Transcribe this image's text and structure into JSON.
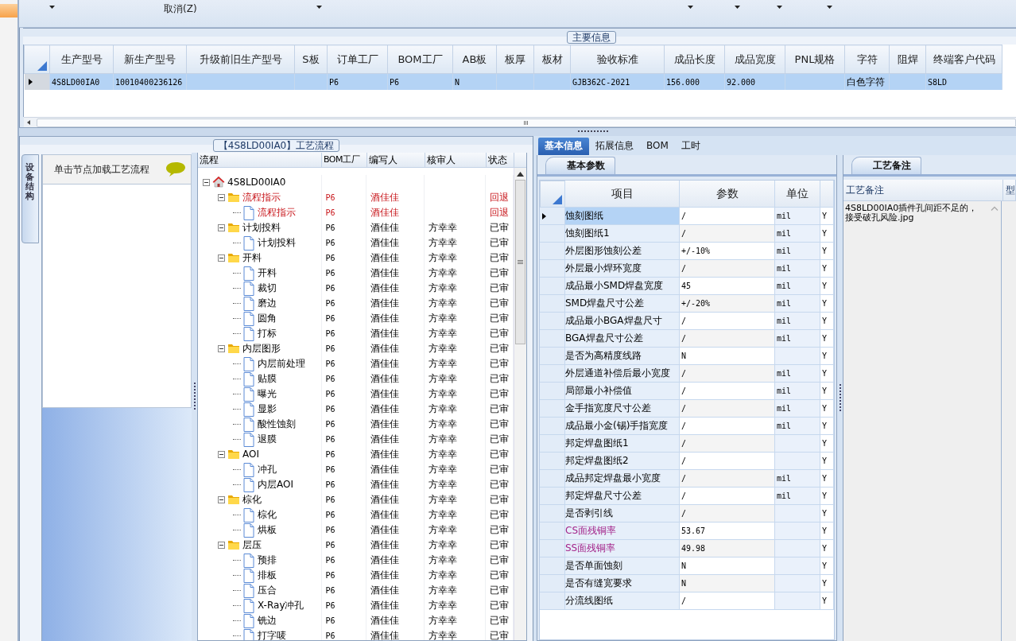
{
  "toolbar": {
    "cancel_label": "取消(Z)"
  },
  "main_info": {
    "title": "主要信息",
    "columns": [
      "生产型号",
      "新生产型号",
      "升级前旧生产型号",
      "S板",
      "订单工厂",
      "BOM工厂",
      "AB板",
      "板厚",
      "板材",
      "验收标准",
      "成品长度",
      "成品宽度",
      "PNL规格",
      "字符",
      "阻焊",
      "终端客户代码"
    ],
    "rows": [
      {
        "selected": true,
        "cells": [
          "4S8LD00IA0",
          "10010400236126",
          "",
          "",
          "P6",
          "P6",
          "N",
          "",
          "",
          "GJB362C-2021",
          "156.000",
          "92.000",
          "",
          "白色字符",
          "",
          "S8LD"
        ]
      }
    ]
  },
  "flow": {
    "title": "【4S8LD00IA0】工艺流程",
    "side_tab": "设备结构",
    "hint": "单击节点加载工艺流程",
    "columns": [
      "流程",
      "BOM工厂",
      "编写人",
      "核审人",
      "状态"
    ],
    "tree": [
      {
        "label": "4S8LD00IA0",
        "expanded": true,
        "children": [
          {
            "label": "流程指示",
            "factory": "P6",
            "writer": "酒佳佳",
            "status": "回退",
            "alert": true,
            "expanded": true,
            "children": [
              {
                "label": "流程指示",
                "factory": "P6",
                "writer": "酒佳佳",
                "status": "回退",
                "alert": true
              }
            ]
          },
          {
            "label": "计划投料",
            "factory": "P6",
            "writer": "酒佳佳",
            "reviewer": "方幸幸",
            "status": "已审",
            "alert": false,
            "expanded": true,
            "children": [
              {
                "label": "计划投料",
                "factory": "P6",
                "writer": "酒佳佳",
                "reviewer": "方幸幸",
                "status": "已审",
                "alert": false
              }
            ]
          },
          {
            "label": "开料",
            "factory": "P6",
            "writer": "酒佳佳",
            "reviewer": "方幸幸",
            "status": "已审",
            "alert": false,
            "expanded": true,
            "children": [
              {
                "label": "开料",
                "factory": "P6",
                "writer": "酒佳佳",
                "reviewer": "方幸幸",
                "status": "已审",
                "alert": false
              },
              {
                "label": "裁切",
                "factory": "P6",
                "writer": "酒佳佳",
                "reviewer": "方幸幸",
                "status": "已审",
                "alert": false
              },
              {
                "label": "磨边",
                "factory": "P6",
                "writer": "酒佳佳",
                "reviewer": "方幸幸",
                "status": "已审",
                "alert": false
              },
              {
                "label": "圆角",
                "factory": "P6",
                "writer": "酒佳佳",
                "reviewer": "方幸幸",
                "status": "已审",
                "alert": false
              },
              {
                "label": "打标",
                "factory": "P6",
                "writer": "酒佳佳",
                "reviewer": "方幸幸",
                "status": "已审",
                "alert": false
              }
            ]
          },
          {
            "label": "内层图形",
            "factory": "P6",
            "writer": "酒佳佳",
            "reviewer": "方幸幸",
            "status": "已审",
            "alert": false,
            "expanded": true,
            "children": [
              {
                "label": "内层前处理",
                "factory": "P6",
                "writer": "酒佳佳",
                "reviewer": "方幸幸",
                "status": "已审",
                "alert": false
              },
              {
                "label": "贴膜",
                "factory": "P6",
                "writer": "酒佳佳",
                "reviewer": "方幸幸",
                "status": "已审",
                "alert": false
              },
              {
                "label": "曝光",
                "factory": "P6",
                "writer": "酒佳佳",
                "reviewer": "方幸幸",
                "status": "已审",
                "alert": false
              },
              {
                "label": "显影",
                "factory": "P6",
                "writer": "酒佳佳",
                "reviewer": "方幸幸",
                "status": "已审",
                "alert": false
              },
              {
                "label": "酸性蚀刻",
                "factory": "P6",
                "writer": "酒佳佳",
                "reviewer": "方幸幸",
                "status": "已审",
                "alert": false
              },
              {
                "label": "退膜",
                "factory": "P6",
                "writer": "酒佳佳",
                "reviewer": "方幸幸",
                "status": "已审",
                "alert": false
              }
            ]
          },
          {
            "label": "AOI",
            "factory": "P6",
            "writer": "酒佳佳",
            "reviewer": "方幸幸",
            "status": "已审",
            "alert": false,
            "expanded": true,
            "children": [
              {
                "label": "冲孔",
                "factory": "P6",
                "writer": "酒佳佳",
                "reviewer": "方幸幸",
                "status": "已审",
                "alert": false
              },
              {
                "label": "内层AOI",
                "factory": "P6",
                "writer": "酒佳佳",
                "reviewer": "方幸幸",
                "status": "已审",
                "alert": false
              }
            ]
          },
          {
            "label": "棕化",
            "factory": "P6",
            "writer": "酒佳佳",
            "reviewer": "方幸幸",
            "status": "已审",
            "alert": false,
            "expanded": true,
            "children": [
              {
                "label": "棕化",
                "factory": "P6",
                "writer": "酒佳佳",
                "reviewer": "方幸幸",
                "status": "已审",
                "alert": false
              },
              {
                "label": "烘板",
                "factory": "P6",
                "writer": "酒佳佳",
                "reviewer": "方幸幸",
                "status": "已审",
                "alert": false
              }
            ]
          },
          {
            "label": "层压",
            "factory": "P6",
            "writer": "酒佳佳",
            "reviewer": "方幸幸",
            "status": "已审",
            "alert": false,
            "expanded": true,
            "children": [
              {
                "label": "预排",
                "factory": "P6",
                "writer": "酒佳佳",
                "reviewer": "方幸幸",
                "status": "已审",
                "alert": false
              },
              {
                "label": "排板",
                "factory": "P6",
                "writer": "酒佳佳",
                "reviewer": "方幸幸",
                "status": "已审",
                "alert": false
              },
              {
                "label": "压合",
                "factory": "P6",
                "writer": "酒佳佳",
                "reviewer": "方幸幸",
                "status": "已审",
                "alert": false
              },
              {
                "label": "X-Ray冲孔",
                "factory": "P6",
                "writer": "酒佳佳",
                "reviewer": "方幸幸",
                "status": "已审",
                "alert": false
              },
              {
                "label": "铣边",
                "factory": "P6",
                "writer": "酒佳佳",
                "reviewer": "方幸幸",
                "status": "已审",
                "alert": false
              },
              {
                "label": "打字唛",
                "factory": "P6",
                "writer": "酒佳佳",
                "reviewer": "方幸幸",
                "status": "已审",
                "alert": false
              }
            ]
          }
        ]
      }
    ]
  },
  "detail": {
    "tabs": [
      {
        "label": "基本信息",
        "selected": true
      },
      {
        "label": "拓展信息",
        "selected": false
      },
      {
        "label": "BOM",
        "selected": false
      },
      {
        "label": "工时",
        "selected": false
      }
    ],
    "params": {
      "tab": "基本参数",
      "columns": [
        "项目",
        "参数",
        "单位"
      ],
      "rows": [
        {
          "item": "蚀刻图纸",
          "value": "/",
          "unit": "mil",
          "column_4": "Y",
          "selected": true,
          "accent": false
        },
        {
          "item": "蚀刻图纸1",
          "value": "/",
          "unit": "mil",
          "column_4": "Y",
          "selected": false,
          "accent": false
        },
        {
          "item": "外层图形蚀刻公差",
          "value": "+/-10%",
          "unit": "mil",
          "column_4": "Y",
          "selected": false,
          "accent": false
        },
        {
          "item": "外层最小焊环宽度",
          "value": "/",
          "unit": "mil",
          "column_4": "Y",
          "selected": false,
          "accent": false
        },
        {
          "item": "成品最小SMD焊盘宽度",
          "value": "45",
          "unit": "mil",
          "column_4": "Y",
          "selected": false,
          "accent": false
        },
        {
          "item": "SMD焊盘尺寸公差",
          "value": "+/-20%",
          "unit": "mil",
          "column_4": "Y",
          "selected": false,
          "accent": false
        },
        {
          "item": "成品最小BGA焊盘尺寸",
          "value": "/",
          "unit": "mil",
          "column_4": "Y",
          "selected": false,
          "accent": false
        },
        {
          "item": "BGA焊盘尺寸公差",
          "value": "/",
          "unit": "mil",
          "column_4": "Y",
          "selected": false,
          "accent": false
        },
        {
          "item": "是否为高精度线路",
          "value": "N",
          "column_4": "Y",
          "selected": false,
          "accent": false
        },
        {
          "item": "外层通道补偿后最小宽度",
          "value": "/",
          "unit": "mil",
          "column_4": "Y",
          "selected": false,
          "accent": false
        },
        {
          "item": "局部最小补偿值",
          "value": "/",
          "unit": "mil",
          "column_4": "Y",
          "selected": false,
          "accent": false
        },
        {
          "item": "金手指宽度尺寸公差",
          "value": "/",
          "unit": "mil",
          "column_4": "Y",
          "selected": false,
          "accent": false
        },
        {
          "item": "成品最小金(锡)手指宽度",
          "value": "/",
          "unit": "mil",
          "column_4": "Y",
          "selected": false,
          "accent": false
        },
        {
          "item": "邦定焊盘图纸1",
          "value": "/",
          "column_4": "Y",
          "selected": false,
          "accent": false
        },
        {
          "item": "邦定焊盘图纸2",
          "value": "/",
          "column_4": "Y",
          "selected": false,
          "accent": false
        },
        {
          "item": "成品邦定焊盘最小宽度",
          "value": "/",
          "unit": "mil",
          "column_4": "Y",
          "selected": false,
          "accent": false
        },
        {
          "item": "邦定焊盘尺寸公差",
          "value": "/",
          "unit": "mil",
          "column_4": "Y",
          "selected": false,
          "accent": false
        },
        {
          "item": "是否剥引线",
          "value": "/",
          "column_4": "Y",
          "selected": false,
          "accent": false
        },
        {
          "item": "CS面残铜率",
          "value": "53.67",
          "column_4": "Y",
          "selected": false,
          "accent": true
        },
        {
          "item": "SS面残铜率",
          "value": "49.98",
          "column_4": "Y",
          "selected": false,
          "accent": true
        },
        {
          "item": "是否单面蚀刻",
          "value": "N",
          "column_4": "Y",
          "selected": false,
          "accent": false
        },
        {
          "item": "是否有缝宽要求",
          "value": "N",
          "column_4": "Y",
          "selected": false,
          "accent": false
        },
        {
          "item": "分流线图纸",
          "value": "/",
          "column_4": "Y",
          "selected": false,
          "accent": false
        }
      ]
    },
    "notes": {
      "tab": "工艺备注",
      "columns": [
        "工艺备注",
        "型"
      ],
      "note_lines": [
        "4S8LD00IA0插件孔间距不足的，",
        "接受破孔风险.jpg"
      ]
    }
  }
}
